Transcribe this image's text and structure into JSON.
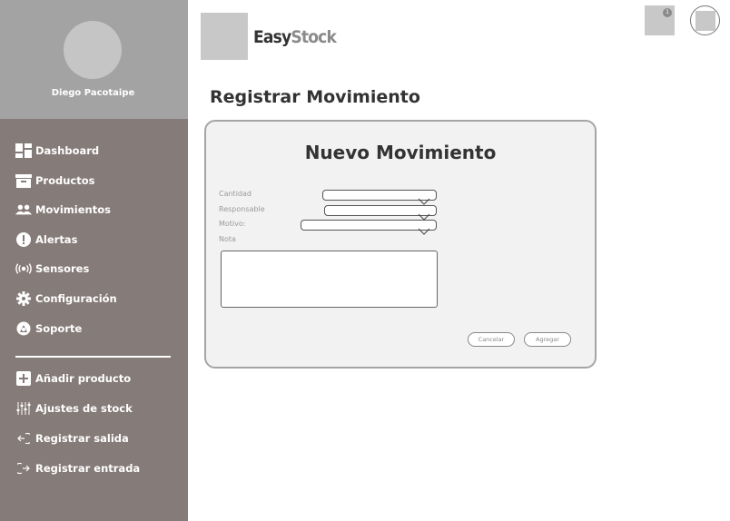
{
  "user": {
    "name": "Diego Pacotaipe"
  },
  "nav": {
    "main": [
      {
        "label": "Dashboard",
        "icon": "dashboard-icon"
      },
      {
        "label": "Productos",
        "icon": "box-icon"
      },
      {
        "label": "Movimientos",
        "icon": "users-icon"
      },
      {
        "label": "Alertas",
        "icon": "alert-icon"
      },
      {
        "label": "Sensores",
        "icon": "sensor-icon"
      },
      {
        "label": "Configuración",
        "icon": "gear-icon"
      },
      {
        "label": "Soporte",
        "icon": "support-icon"
      }
    ],
    "actions": [
      {
        "label": "Añadir producto",
        "icon": "plus-icon"
      },
      {
        "label": "Ajustes de stock",
        "icon": "sliders-icon"
      },
      {
        "label": "Registrar salida",
        "icon": "logout-icon"
      },
      {
        "label": "Registrar entrada",
        "icon": "login-icon"
      }
    ]
  },
  "header": {
    "brand_part1": "Easy",
    "brand_part2": "Stock",
    "notification_count": "1"
  },
  "page": {
    "title": "Registrar Movimiento"
  },
  "form": {
    "title": "Nuevo Movimiento",
    "fields": {
      "cantidad": {
        "label": "Cantidad",
        "value": ""
      },
      "responsable": {
        "label": "Responsable",
        "value": ""
      },
      "motivo": {
        "label": "Motivo:",
        "value": ""
      },
      "nota": {
        "label": "Nota",
        "value": ""
      }
    },
    "buttons": {
      "cancel": "Cancelar",
      "submit": "Agregar"
    }
  },
  "colors": {
    "sidebar": "#857b78",
    "profile": "#a3a3a3",
    "card_bg": "#f2f2f2",
    "card_border": "#a5a5a5",
    "brand_accent": "#8a8a8a"
  }
}
